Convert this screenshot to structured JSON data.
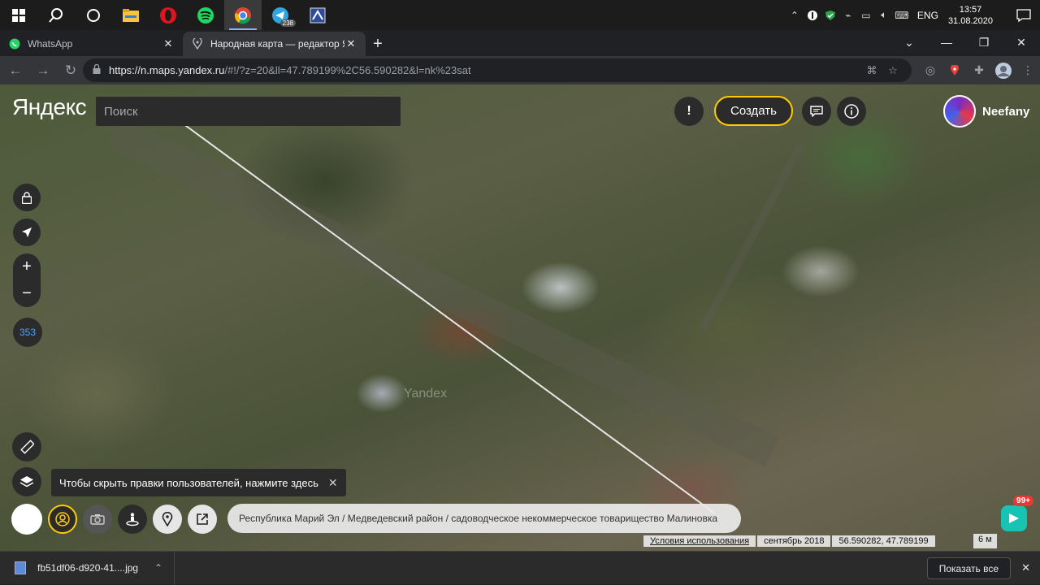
{
  "taskbar": {
    "icons": [
      "windows-start-icon",
      "search-icon",
      "task-view-icon",
      "file-explorer-icon",
      "opera-icon",
      "spotify-icon",
      "chrome-icon",
      "telegram-icon",
      "app-icon"
    ],
    "telegram_badge": "238",
    "lang": "ENG",
    "time": "13:57",
    "date": "31.08.2020"
  },
  "browser": {
    "tabs": [
      {
        "label": "WhatsApp",
        "icon": "whatsapp-icon"
      },
      {
        "label": "Народная карта — редактор Ян",
        "icon": "map-pin-icon"
      }
    ],
    "url_main": "https://n.maps.yandex.ru",
    "url_rest": "/#!/?z=20&ll=47.789199%2C56.590282&l=nk%23sat"
  },
  "map": {
    "logo": "Яндекс",
    "search_placeholder": "Поиск",
    "create_label": "Создать",
    "user_name": "Neefany",
    "edits_count": "353",
    "tooltip_text": "Чтобы скрыть правки пользователей, нажмите здесь",
    "address": "Республика Марий Эл / Медведевский район / садоводческое некоммерческое товарищество Малиновка",
    "terms_label": "Условия использования",
    "imagery_date": "сентябрь 2018",
    "coords": "56.590282, 47.789199",
    "scale_label": "6 м",
    "notifications": "99+",
    "watermark": "Yandex"
  },
  "downloads": {
    "file_name": "fb51df06-d920-41....jpg",
    "show_all": "Показать все"
  }
}
